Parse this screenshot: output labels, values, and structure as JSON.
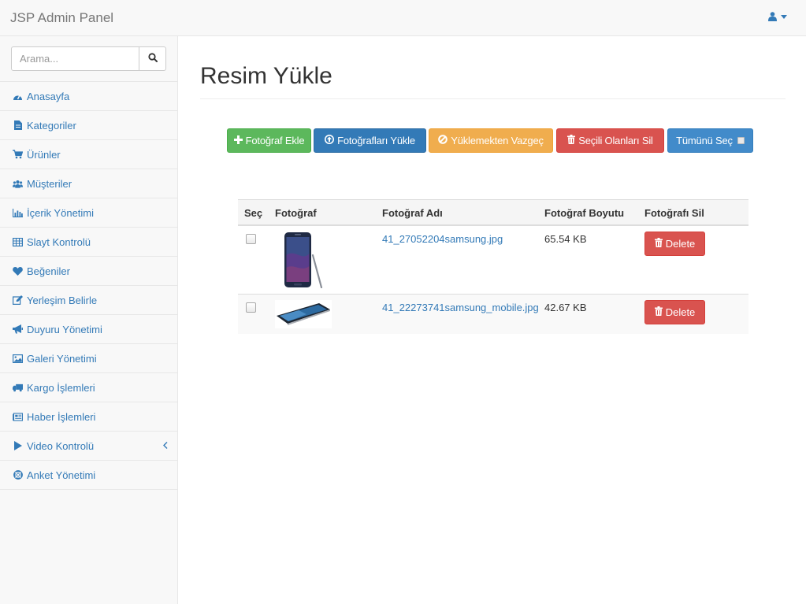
{
  "app": {
    "brand": "JSP Admin Panel"
  },
  "search": {
    "placeholder": "Arama..."
  },
  "sidebar": {
    "items": [
      {
        "label": "Anasayfa",
        "icon": "dashboard-icon"
      },
      {
        "label": "Kategoriler",
        "icon": "file-icon"
      },
      {
        "label": "Ürünler",
        "icon": "cart-icon"
      },
      {
        "label": "Müşteriler",
        "icon": "users-icon"
      },
      {
        "label": "İçerik Yönetimi",
        "icon": "bar-chart-icon"
      },
      {
        "label": "Slayt Kontrolü",
        "icon": "table-icon"
      },
      {
        "label": "Beğeniler",
        "icon": "heart-icon"
      },
      {
        "label": "Yerleşim Belirle",
        "icon": "edit-icon"
      },
      {
        "label": "Duyuru Yönetimi",
        "icon": "bullhorn-icon"
      },
      {
        "label": "Galeri Yönetimi",
        "icon": "image-icon"
      },
      {
        "label": "Kargo İşlemleri",
        "icon": "truck-icon"
      },
      {
        "label": "Haber İşlemleri",
        "icon": "newspaper-icon"
      },
      {
        "label": "Video Kontrolü",
        "icon": "play-icon"
      },
      {
        "label": "Anket Yönetimi",
        "icon": "lifebuoy-icon"
      }
    ]
  },
  "main": {
    "title": "Resim Yükle",
    "buttons": {
      "add": "Fotoğraf Ekle",
      "upload": "Fotoğrafları Yükle",
      "cancel": "Yüklemekten Vazgeç",
      "delete_selected": "Seçili Olanları Sil",
      "select_all": "Tümünü Seç"
    },
    "table": {
      "headers": [
        "Seç",
        "Fotoğraf",
        "Fotoğraf Adı",
        "Fotoğraf Boyutu",
        "Fotoğrafı Sil"
      ],
      "rows": [
        {
          "name": "41_27052204samsung.jpg",
          "size": "65.54 KB",
          "delete_label": "Delete"
        },
        {
          "name": "41_22273741samsung_mobile.jpg",
          "size": "42.67 KB",
          "delete_label": "Delete"
        }
      ]
    }
  },
  "colors": {
    "primary": "#337ab7",
    "success": "#5cb85c",
    "warning": "#f0ad4e",
    "danger": "#d9534f",
    "info_blue": "#428bca"
  }
}
